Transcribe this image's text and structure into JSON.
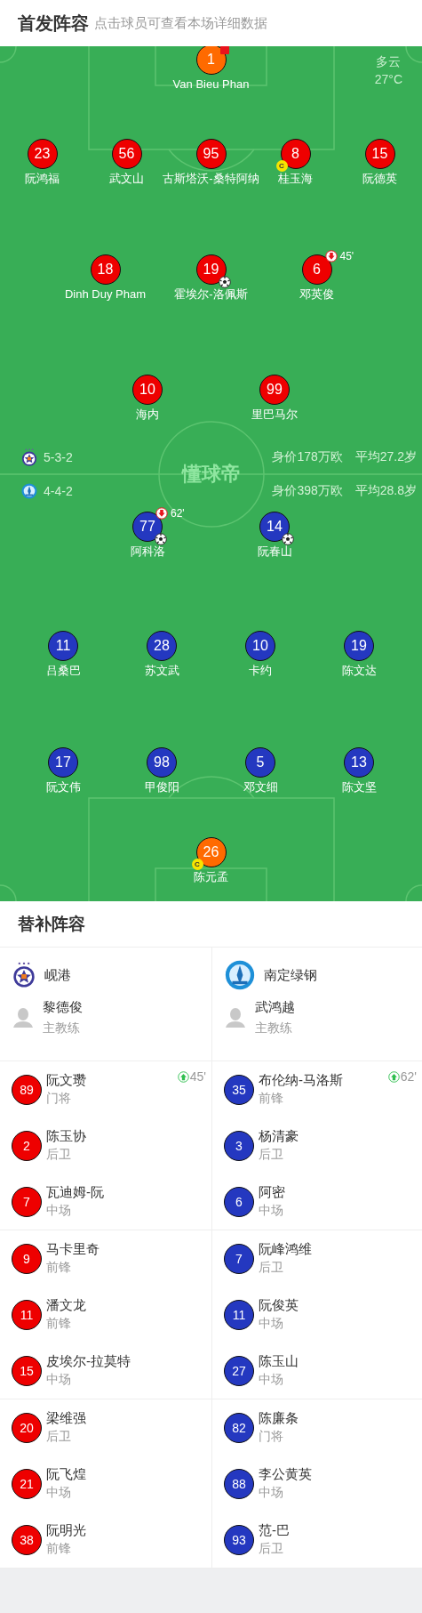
{
  "header": {
    "title": "首发阵容",
    "subtitle": "点击球员可查看本场详细数据"
  },
  "weather": {
    "condition": "多云",
    "temperature": "27°C"
  },
  "watermark": "懂球帝",
  "home": {
    "formation": "5-3-2",
    "value": "身价178万欧",
    "average_age": "平均27.2岁",
    "rows": [
      {
        "color": "#ff6a00",
        "players": [
          {
            "number": "1",
            "name": "Van Bieu Phan",
            "events": [
              {
                "kind": "red_card"
              }
            ]
          }
        ]
      },
      {
        "color": "#ee0000",
        "players": [
          {
            "number": "23",
            "name": "阮鸿福"
          },
          {
            "number": "56",
            "name": "武文山"
          },
          {
            "number": "95",
            "name": "古斯塔沃-桑特阿纳"
          },
          {
            "number": "8",
            "name": "桂玉海",
            "events": [
              {
                "kind": "captain",
                "label": "C"
              }
            ]
          },
          {
            "number": "15",
            "name": "阮德英"
          }
        ]
      },
      {
        "color": "#ee0000",
        "players": [
          {
            "number": "18",
            "name": "Dinh Duy Pham"
          },
          {
            "number": "19",
            "name": "霍埃尔-洛佩斯",
            "events": [
              {
                "kind": "goal"
              }
            ]
          },
          {
            "number": "6",
            "name": "邓英俊",
            "events": [
              {
                "kind": "sub_off",
                "minute": "45'"
              }
            ]
          }
        ]
      },
      {
        "color": "#ee0000",
        "players": [
          {
            "number": "10",
            "name": "海内"
          },
          {
            "number": "99",
            "name": "里巴马尔"
          }
        ]
      }
    ]
  },
  "away": {
    "formation": "4-4-2",
    "value": "身价398万欧",
    "average_age": "平均28.8岁",
    "rows": [
      {
        "color": "#2438c0",
        "players": [
          {
            "number": "77",
            "name": "阿科洛",
            "events": [
              {
                "kind": "sub_off",
                "minute": "62'"
              },
              {
                "kind": "goal"
              }
            ]
          },
          {
            "number": "14",
            "name": "阮春山",
            "events": [
              {
                "kind": "goal"
              }
            ]
          }
        ]
      },
      {
        "color": "#2438c0",
        "players": [
          {
            "number": "11",
            "name": "吕桑巴"
          },
          {
            "number": "28",
            "name": "苏文武"
          },
          {
            "number": "10",
            "name": "卡约"
          },
          {
            "number": "19",
            "name": "陈文达"
          }
        ]
      },
      {
        "color": "#2438c0",
        "players": [
          {
            "number": "17",
            "name": "阮文伟"
          },
          {
            "number": "98",
            "name": "甲俊阳"
          },
          {
            "number": "5",
            "name": "邓文细"
          },
          {
            "number": "13",
            "name": "陈文坚"
          }
        ]
      },
      {
        "color": "#ff6a00",
        "players": [
          {
            "number": "26",
            "name": "陈元孟",
            "events": [
              {
                "kind": "captain",
                "label": "C"
              }
            ]
          }
        ]
      }
    ]
  },
  "substitutes": {
    "title": "替补阵容",
    "teams": [
      {
        "name": "岘港",
        "color": "#ee0000",
        "coach": {
          "name": "黎德俊",
          "role": "主教练"
        },
        "players": [
          {
            "number": "89",
            "name": "阮文瓒",
            "position": "门将",
            "sub_in": "45'"
          },
          {
            "number": "2",
            "name": "陈玉协",
            "position": "后卫"
          },
          {
            "number": "7",
            "name": "瓦迪姆-阮",
            "position": "中场"
          },
          {
            "number": "9",
            "name": "马卡里奇",
            "position": "前锋"
          },
          {
            "number": "11",
            "name": "潘文龙",
            "position": "前锋"
          },
          {
            "number": "15",
            "name": "皮埃尔-拉莫特",
            "position": "中场"
          },
          {
            "number": "20",
            "name": "梁维强",
            "position": "后卫"
          },
          {
            "number": "21",
            "name": "阮飞煌",
            "position": "中场"
          },
          {
            "number": "38",
            "name": "阮明光",
            "position": "前锋"
          }
        ]
      },
      {
        "name": "南定绿钢",
        "color": "#2438c0",
        "coach": {
          "name": "武鸿越",
          "role": "主教练"
        },
        "players": [
          {
            "number": "35",
            "name": "布伦纳-马洛斯",
            "position": "前锋",
            "sub_in": "62'"
          },
          {
            "number": "3",
            "name": "杨清豪",
            "position": "后卫"
          },
          {
            "number": "6",
            "name": "阿密",
            "position": "中场"
          },
          {
            "number": "7",
            "name": "阮峰鸿维",
            "position": "后卫"
          },
          {
            "number": "11",
            "name": "阮俊英",
            "position": "中场"
          },
          {
            "number": "27",
            "name": "陈玉山",
            "position": "中场"
          },
          {
            "number": "82",
            "name": "陈廉条",
            "position": "门将"
          },
          {
            "number": "88",
            "name": "李公黄英",
            "position": "中场"
          },
          {
            "number": "93",
            "name": "范-巴",
            "position": "后卫"
          }
        ]
      }
    ]
  }
}
